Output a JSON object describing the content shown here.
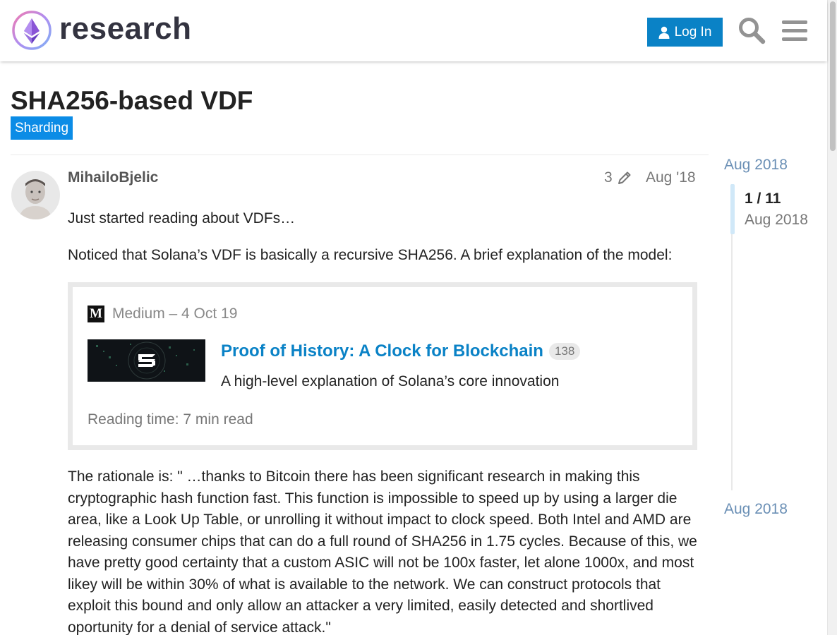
{
  "header": {
    "logo_text": "research",
    "login_label": "Log In",
    "search_icon": "search-icon",
    "menu_icon": "hamburger-menu-icon"
  },
  "topic": {
    "title": "SHA256-based VDF",
    "category": "Sharding",
    "category_color": "#0b8ce6"
  },
  "post": {
    "username": "MihailoBjelic",
    "edit_count": "3",
    "date": "Aug '18",
    "paragraph1": "Just started reading about VDFs…",
    "paragraph2": "Noticed that Solana’s VDF is basically a recursive SHA256. A brief explanation of the model:",
    "onebox": {
      "source": "Medium – 4 Oct 19",
      "source_icon": "M",
      "title": "Proof of History: A Clock for Blockchain",
      "click_count": "138",
      "description": "A high-level explanation of Solana’s core innovation",
      "reading_time": "Reading time: 7 min read"
    },
    "paragraph3": "The rationale is: \" …thanks to Bitcoin there has been significant research in making this cryptographic hash function fast. This function is impossible to speed up by using a larger die area, like a Look Up Table, or unrolling it without impact to clock speed. Both Intel and AMD are releasing consumer chips that can do a full round of SHA256 in 1.75 cycles. Because of this, we have pretty good certainty that a custom ASIC will not be 100x faster, let alone 1000x, and most likey will be within 30% of what is available to the network. We can construct protocols that exploit this bound and only allow an attacker a very limited, easily detected and shortlived oportunity for a denial of service attack.\""
  },
  "timeline": {
    "start_date": "Aug 2018",
    "position": "1 / 11",
    "current_date": "Aug 2018",
    "end_date": "Aug 2018"
  },
  "colors": {
    "accent": "#0a82c6",
    "link": "#0a82c6"
  }
}
